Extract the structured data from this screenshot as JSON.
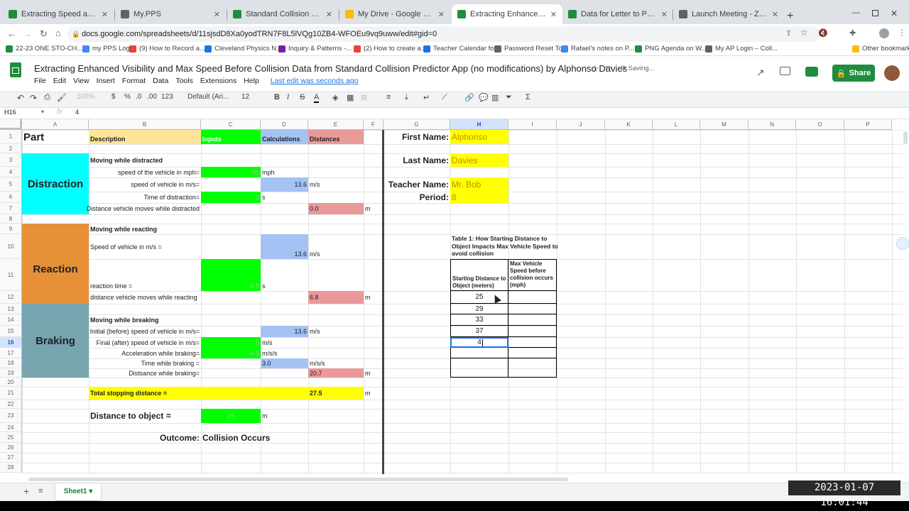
{
  "browser": {
    "tabs": [
      {
        "title": "Extracting Speed and Stopping ...",
        "icon": "sheets-icon",
        "color": "#1e8e3e",
        "active": false
      },
      {
        "title": "My.PPS",
        "icon": "page-icon",
        "color": "#5f6368",
        "active": false
      },
      {
        "title": "Standard Collision Predictor App",
        "icon": "sheets-icon",
        "color": "#1e8e3e",
        "active": false
      },
      {
        "title": "My Drive - Google Drive",
        "icon": "drive-icon",
        "color": "#fbbc04",
        "active": false
      },
      {
        "title": "Extracting Enhanced Visibility a",
        "icon": "sheets-icon",
        "color": "#1e8e3e",
        "active": true
      },
      {
        "title": "Data for Letter to Public Official",
        "icon": "sheets-icon",
        "color": "#1e8e3e",
        "active": false
      },
      {
        "title": "Launch Meeting - Zoom",
        "icon": "globe-icon",
        "color": "#5f6368",
        "active": false
      }
    ],
    "url": "docs.google.com/spreadsheets/d/11sjsdD8Xa0yodTRN7F8L5lVQg10ZB4-WFOEu9vq9uww/edit#gid=0",
    "bookmarks": [
      "22-23 ONE STO-CH...",
      "my PPS Login",
      "(9) How to Record a...",
      "Cleveland Physics N...",
      "Inquiry & Patterns -...",
      "(2) How to create a...",
      "Teacher Calendar fo...",
      "Password Reset Tool",
      "Rafael's notes on P...",
      "PNG Agenda on W...",
      "My AP Login – Coll..."
    ],
    "other_bookmarks": "Other bookmarks"
  },
  "doc": {
    "title": "Extracting Enhanced Visibility and Max Speed Before Collision Data from Standard Collision Predictor App (no modifications) by Alphonso Davies",
    "saving": "Saving...",
    "share": "Share",
    "menu": [
      "File",
      "Edit",
      "View",
      "Insert",
      "Format",
      "Data",
      "Tools",
      "Extensions",
      "Help"
    ],
    "last_edit": "Last edit was seconds ago",
    "toolbar": {
      "zoom": "100%",
      "currency": "$",
      "percent": "%",
      "dec1": ".0",
      "dec2": ".00",
      "fmt": "123",
      "font": "Default (Ari...",
      "size": "12"
    },
    "cell_ref": "H16",
    "formula": "4"
  },
  "grid": {
    "columns": [
      "A",
      "B",
      "C",
      "D",
      "E",
      "F",
      "G",
      "H",
      "I",
      "J",
      "K",
      "L",
      "M",
      "N",
      "O",
      "P"
    ],
    "rows": [
      "1",
      "2",
      "3",
      "4",
      "5",
      "6",
      "7",
      "8",
      "9",
      "10",
      "11",
      "12",
      "13",
      "14",
      "15",
      "16",
      "17",
      "18",
      "19",
      "20",
      "21",
      "22",
      "23",
      "24",
      "25",
      "26",
      "27",
      "28"
    ]
  },
  "sheet": {
    "part": "Part",
    "description": "Description",
    "inputs": "Inputs",
    "calculations": "Calculations",
    "distances": "Distances",
    "distraction": "Distraction",
    "reaction": "Reaction",
    "braking": "Braking",
    "moving_distracted": "Moving while distracted",
    "speed_mph_label": "speed of the vehicle in mph=",
    "speed_mph": "30",
    "mph": "mph",
    "speed_ms_label": "speed of vehicle in m/s=",
    "speed_ms": "13.6",
    "ms": "m/s",
    "time_distraction_label": "Time of distraction=",
    "time_distraction": "0",
    "s": "s",
    "dist_distracted_label": "Distance vehicle moves while distracted",
    "dist_distracted": "0.0",
    "m": "m",
    "moving_reacting": "Moving while reacting",
    "speed_ms_label2": "Speed of vehicle in m/s =",
    "speed_ms2": "13.6",
    "reaction_time_label": "reaction time =",
    "reaction_time": "0.5",
    "dist_reacting_label": "distance vehicle moves while reacting",
    "dist_reacting": "6.8",
    "moving_braking": "Moving while breaking",
    "initial_speed_label": "Initial (before) speed of vehicle in m/s=",
    "initial_speed": "13.6",
    "final_speed_label": "Final (after) speed of vehicle in m/s=",
    "final_speed": "0",
    "accel_label": "Acceleration while braking=",
    "accel": "-4.5",
    "accel_unit": "m/s/s",
    "time_braking_label": "Time while braking =",
    "time_braking": "3.0",
    "dist_braking_label": "Distsance while braking=",
    "dist_braking": "20.7",
    "total_label": "Total stopping distance =",
    "total": "27.5",
    "dist_obj_label": "Distance to object =",
    "dist_obj": "25",
    "outcome_label": "Outcome:",
    "outcome": "Collision Occurs",
    "first_name_label": "First Name:",
    "first_name": "Alphonso",
    "last_name_label": "Last Name:",
    "last_name": "Davies",
    "teacher_label": "Teacher Name:",
    "teacher": "Mr. Bob",
    "period_label": "Period:",
    "period": "8",
    "table_title": "Table 1: How Starting Distance to Object Impacts Max Vehicle Speed to avoid collision",
    "col1": "Starting Distance to Object (meters)",
    "col2": "Max Vehicle Speed before collision occurs (mph)",
    "t_rows": [
      "25",
      "29",
      "33",
      "37",
      "4"
    ]
  },
  "sheet_tab": "Sheet1",
  "timestamp": "2023-01-07  16:01:44"
}
